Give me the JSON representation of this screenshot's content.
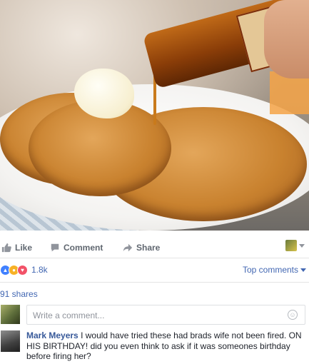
{
  "post": {
    "photo_alt": ""
  },
  "actions": {
    "like_label": "Like",
    "comment_label": "Comment",
    "share_label": "Share"
  },
  "reactions": {
    "count": "1.8k",
    "top_comments_label": "Top comments"
  },
  "shares": {
    "label": "91 shares"
  },
  "write_comment": {
    "placeholder": "Write a comment..."
  },
  "comments": [
    {
      "author": "Mark Meyers",
      "text": "I would have tried these had brads wife not been fired. ON HIS BIRTHDAY! did you even think to ask if it was someones birthday before firing her?"
    }
  ],
  "colors": {
    "link": "#4267b2",
    "author": "#365899",
    "muted": "#606770",
    "like_reaction": "#4080ff",
    "angry_reaction": "#f7b125",
    "love_reaction": "#f25268"
  },
  "icons": {
    "like": "thumbs-up-icon",
    "comment": "speech-bubble-icon",
    "share": "share-arrow-icon",
    "emoji": "smiley-icon"
  }
}
